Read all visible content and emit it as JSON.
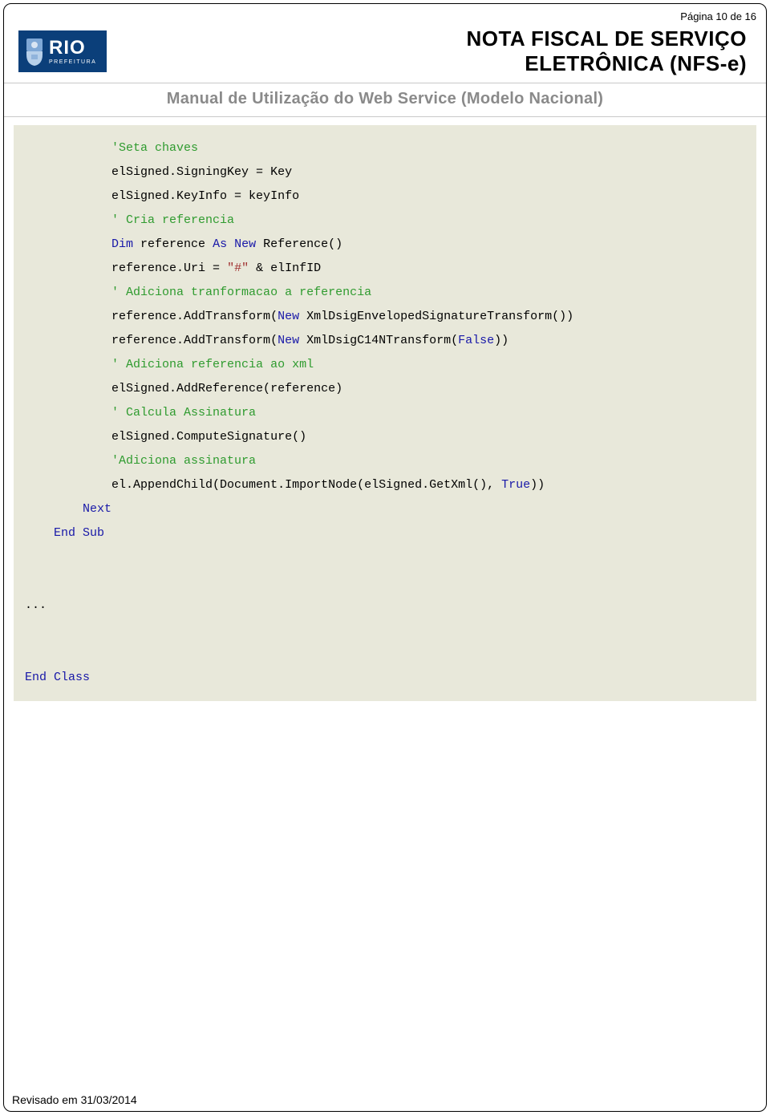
{
  "page": {
    "page_number_label": "Página 10 de 16",
    "revision_label": "Revisado em 31/03/2014"
  },
  "header": {
    "logo_main": "RIO",
    "logo_sub": "PREFEITURA",
    "title_line1": "NOTA FISCAL DE SERVIÇO",
    "title_line2": "ELETRÔNICA (NFS-e)"
  },
  "subheader": {
    "text": "Manual de Utilização do Web Service (Modelo Nacional)"
  },
  "code": {
    "language": "VB.NET",
    "indent_step": "    ",
    "lines": [
      {
        "indent": 3,
        "tokens": [
          {
            "t": "'Seta chaves",
            "k": "comment"
          }
        ]
      },
      {
        "indent": 3,
        "tokens": [
          {
            "t": "elSigned.SigningKey = Key",
            "k": "plain"
          }
        ]
      },
      {
        "indent": 3,
        "tokens": [
          {
            "t": "elSigned.KeyInfo = keyInfo",
            "k": "plain"
          }
        ]
      },
      {
        "indent": 3,
        "tokens": [
          {
            "t": "' Cria referencia",
            "k": "comment"
          }
        ]
      },
      {
        "indent": 3,
        "tokens": [
          {
            "t": "Dim",
            "k": "keyword"
          },
          {
            "t": " reference ",
            "k": "plain"
          },
          {
            "t": "As",
            "k": "keyword"
          },
          {
            "t": " ",
            "k": "plain"
          },
          {
            "t": "New",
            "k": "keyword"
          },
          {
            "t": " Reference()",
            "k": "plain"
          }
        ]
      },
      {
        "indent": 3,
        "tokens": [
          {
            "t": "reference.Uri = ",
            "k": "plain"
          },
          {
            "t": "\"#\"",
            "k": "string"
          },
          {
            "t": " & elInfID",
            "k": "plain"
          }
        ]
      },
      {
        "indent": 3,
        "tokens": [
          {
            "t": "' Adiciona tranformacao a referencia",
            "k": "comment"
          }
        ]
      },
      {
        "indent": 3,
        "tokens": [
          {
            "t": "reference.AddTransform(",
            "k": "plain"
          },
          {
            "t": "New",
            "k": "keyword"
          },
          {
            "t": " XmlDsigEnvelopedSignatureTransform())",
            "k": "plain"
          }
        ]
      },
      {
        "indent": 3,
        "tokens": [
          {
            "t": "reference.AddTransform(",
            "k": "plain"
          },
          {
            "t": "New",
            "k": "keyword"
          },
          {
            "t": " XmlDsigC14NTransform(",
            "k": "plain"
          },
          {
            "t": "False",
            "k": "bool"
          },
          {
            "t": "))",
            "k": "plain"
          }
        ]
      },
      {
        "indent": 3,
        "tokens": [
          {
            "t": "' Adiciona referencia ao xml",
            "k": "comment"
          }
        ]
      },
      {
        "indent": 3,
        "tokens": [
          {
            "t": "elSigned.AddReference(reference)",
            "k": "plain"
          }
        ]
      },
      {
        "indent": 3,
        "tokens": [
          {
            "t": "' Calcula Assinatura",
            "k": "comment"
          }
        ]
      },
      {
        "indent": 3,
        "tokens": [
          {
            "t": "elSigned.ComputeSignature()",
            "k": "plain"
          }
        ]
      },
      {
        "indent": 3,
        "tokens": [
          {
            "t": "'Adiciona assinatura",
            "k": "comment"
          }
        ]
      },
      {
        "indent": 3,
        "tokens": [
          {
            "t": "el.AppendChild(Document.ImportNode(elSigned.GetXml(), ",
            "k": "plain"
          },
          {
            "t": "True",
            "k": "bool"
          },
          {
            "t": "))",
            "k": "plain"
          }
        ]
      },
      {
        "indent": 2,
        "tokens": [
          {
            "t": "Next",
            "k": "keyword"
          }
        ]
      },
      {
        "indent": 1,
        "tokens": [
          {
            "t": "End",
            "k": "keyword"
          },
          {
            "t": " ",
            "k": "plain"
          },
          {
            "t": "Sub",
            "k": "keyword"
          }
        ]
      },
      {
        "indent": 0,
        "tokens": []
      },
      {
        "indent": 0,
        "tokens": []
      },
      {
        "indent": 0,
        "tokens": [
          {
            "t": "...",
            "k": "plain"
          }
        ]
      },
      {
        "indent": 0,
        "tokens": []
      },
      {
        "indent": 0,
        "tokens": []
      },
      {
        "indent": 0,
        "tokens": [
          {
            "t": "End",
            "k": "keyword"
          },
          {
            "t": " ",
            "k": "plain"
          },
          {
            "t": "Class",
            "k": "keyword"
          }
        ]
      }
    ]
  }
}
